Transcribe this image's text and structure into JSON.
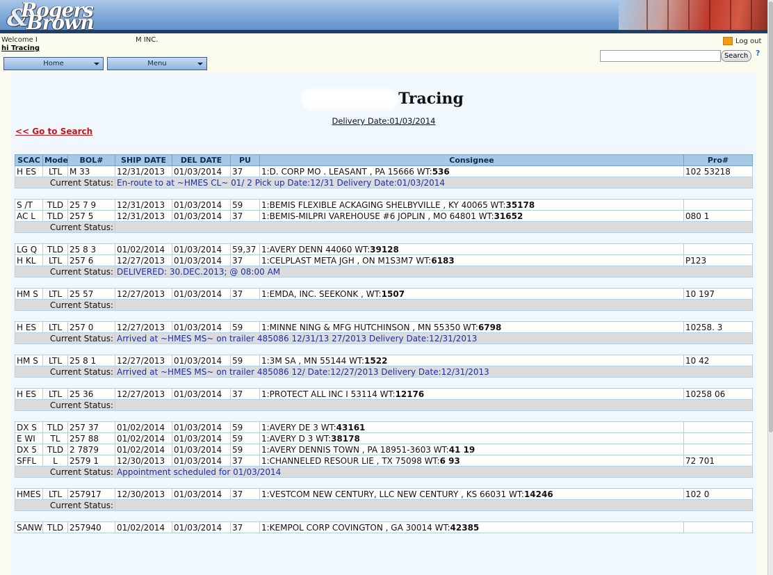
{
  "header": {
    "logo_line1": "Rogers",
    "logo_line2": "Brown",
    "logo_amp": "&"
  },
  "user": {
    "welcome": "Welcome I",
    "company": "M INC.",
    "breadcrumb": "hi Tracing",
    "logout": "Log out"
  },
  "search": {
    "placeholder": "",
    "button": "Search",
    "help": "?"
  },
  "nav": {
    "home": "Home",
    "menu": "Menu"
  },
  "page": {
    "title": "Tracing",
    "delivery_date": "Delivery Date:01/03/2014",
    "go_to_search": "<< Go to Search"
  },
  "table": {
    "columns": [
      "SCAC",
      "Mode",
      "BOL#",
      "SHIP DATE",
      "DEL DATE",
      "PU",
      "Consignee",
      "Pro#"
    ],
    "status_label": "Current Status:",
    "groups": [
      {
        "shipments": [
          {
            "scac": "H ES",
            "mode": "LTL",
            "bol": "M    33",
            "ship": "12/31/2013",
            "del": "01/03/2014",
            "pu": "37",
            "consignee": "1:D.                CORP MO    . LEASANT , PA 15666 WT:",
            "wt": "536",
            "pro": "102    53218"
          }
        ],
        "status": "En-route to                at ~HMES CL~ 01/                        2 Pick up Date:12/31            Delivery Date:01/03/2014"
      },
      {
        "shipments": [
          {
            "scac": "S  /T",
            "mode": "TLD",
            "bol": "25  7 9",
            "ship": "12/31/2013",
            "del": "01/03/2014",
            "pu": "59",
            "consignee": "1:BEMIS FLEXIBLE  ACKAGING SHELBYVILLE , KY 40065 WT:",
            "wt": "35178",
            "pro": ""
          },
          {
            "scac": "AC  L",
            "mode": "TLD",
            "bol": "257   5",
            "ship": "12/31/2013",
            "del": "01/03/2014",
            "pu": "37",
            "consignee": "1:BEMIS-MILPRI                          VAREHOUSE #6 JOPLIN , MO 64801 WT:",
            "wt": "31652",
            "pro": "080      1"
          }
        ],
        "status": ""
      },
      {
        "shipments": [
          {
            "scac": "LG  Q",
            "mode": "TLD",
            "bol": "25  8  3",
            "ship": "01/02/2014",
            "del": "01/03/2014",
            "pu": "59,37",
            "consignee": "1:AVERY DENN                         44060 WT:",
            "wt": "39128",
            "pro": ""
          },
          {
            "scac": "H  KL",
            "mode": "LTL",
            "bol": "257   6",
            "ship": "12/27/2013",
            "del": "01/03/2014",
            "pu": "37",
            "consignee": "1:CELPLAST META                                       JGH , ON M1S3M7 WT:",
            "wt": "6183",
            "pro": "P123"
          }
        ],
        "status": "DELIVERED: 30.DEC.2013; @ 08:00 AM"
      },
      {
        "shipments": [
          {
            "scac": "HM  S",
            "mode": "LTL",
            "bol": "25   57",
            "ship": "12/27/2013",
            "del": "01/03/2014",
            "pu": "37",
            "consignee": "1:EMDA, INC. SEEKONK ,              WT:",
            "wt": "1507",
            "pro": "10          197"
          }
        ],
        "status": ""
      },
      {
        "shipments": [
          {
            "scac": "H  ES",
            "mode": "LTL",
            "bol": "257   0",
            "ship": "12/27/2013",
            "del": "01/03/2014",
            "pu": "59",
            "consignee": "1:MINNE         NING & MFG HUTCHINSON , MN 55350 WT:",
            "wt": "6798",
            "pro": "10258.      3"
          }
        ],
        "status": "Arrived at ~HMES MS~ on trailer 485086 12/31/13                    27/2013 Delivery Date:12/31/2013"
      },
      {
        "shipments": [
          {
            "scac": "HM  S",
            "mode": "LTL",
            "bol": "25  8  1",
            "ship": "12/27/2013",
            "del": "01/03/2014",
            "pu": "59",
            "consignee": "1:3M SA          , MN 55144 WT:",
            "wt": "1522",
            "pro": "10          42"
          }
        ],
        "status": "Arrived at ~HMES MS~ on trailer 485086 12/              Date:12/27/2013 Delivery Date:12/31/2013"
      },
      {
        "shipments": [
          {
            "scac": "H  ES",
            "mode": "LTL",
            "bol": "25  36",
            "ship": "12/27/2013",
            "del": "01/03/2014",
            "pu": "37",
            "consignee": "1:PROTECT ALL INC              I 53114 WT:",
            "wt": "12176",
            "pro": "10258        06"
          }
        ],
        "status": ""
      },
      {
        "shipments": [
          {
            "scac": "DX  S",
            "mode": "TLD",
            "bol": "257  37",
            "ship": "01/02/2014",
            "del": "01/03/2014",
            "pu": "59",
            "consignee": "1:AVERY DE                                      3 WT:",
            "wt": "43161",
            "pro": ""
          },
          {
            "scac": "E  WI",
            "mode": "TL",
            "bol": "257  88",
            "ship": "01/02/2014",
            "del": "01/03/2014",
            "pu": "59",
            "consignee": "1:AVERY D                                       3 WT:",
            "wt": "38178",
            "pro": ""
          },
          {
            "scac": "DX  5",
            "mode": "TLD",
            "bol": "2  7879",
            "ship": "01/02/2014",
            "del": "01/03/2014",
            "pu": "59",
            "consignee": "1:AVERY DENNIS        TOWN , PA 18951-3603 WT:",
            "wt": "41  19",
            "pro": ""
          },
          {
            "scac": "SFFL",
            "mode": "L",
            "bol": "2579  1",
            "ship": "12/30/2013",
            "del": "01/03/2014",
            "pu": "37",
            "consignee": "1:CHANNELED RESOUR            LIE , TX 75098 WT:",
            "wt": "6  93",
            "pro": "72      701"
          }
        ],
        "status": "Appointment scheduled for 01/03/2014"
      },
      {
        "shipments": [
          {
            "scac": "HMES",
            "mode": "LTL",
            "bol": "257917",
            "ship": "12/30/2013",
            "del": "01/03/2014",
            "pu": "37",
            "consignee": "1:VESTCOM NEW CENTURY, LLC NEW CENTURY , KS 66031 WT:",
            "wt": "14246",
            "pro": "102        0"
          }
        ],
        "status": ""
      },
      {
        "shipments": [
          {
            "scac": "SANW",
            "mode": "TLD",
            "bol": "257940",
            "ship": "01/02/2014",
            "del": "01/03/2014",
            "pu": "37",
            "consignee": "1:KEMPOL CORP COVINGTON , GA 30014 WT:",
            "wt": "42385",
            "pro": ""
          }
        ],
        "status": null
      }
    ]
  }
}
